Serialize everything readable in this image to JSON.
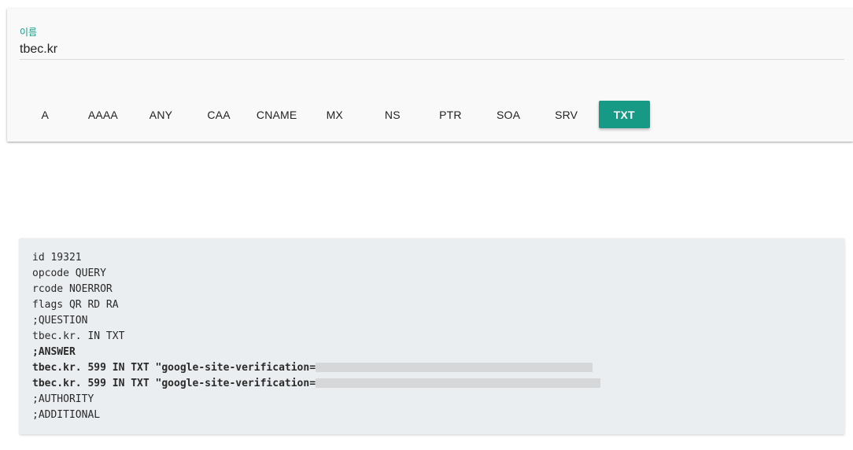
{
  "form": {
    "name_label": "이름",
    "name_value": "tbec.kr"
  },
  "record_types": [
    {
      "label": "A",
      "active": false
    },
    {
      "label": "AAAA",
      "active": false
    },
    {
      "label": "ANY",
      "active": false
    },
    {
      "label": "CAA",
      "active": false
    },
    {
      "label": "CNAME",
      "active": false
    },
    {
      "label": "MX",
      "active": false
    },
    {
      "label": "NS",
      "active": false
    },
    {
      "label": "PTR",
      "active": false
    },
    {
      "label": "SOA",
      "active": false
    },
    {
      "label": "SRV",
      "active": false
    },
    {
      "label": "TXT",
      "active": true
    }
  ],
  "result": {
    "id": "id 19321",
    "opcode": "opcode QUERY",
    "rcode": "rcode NOERROR",
    "flags": "flags QR RD RA",
    "question_header": ";QUESTION",
    "question": "tbec.kr. IN TXT",
    "answer_header": ";ANSWER",
    "answer_1": "tbec.kr. 599 IN TXT \"google-site-verification=",
    "answer_2": "tbec.kr. 599 IN TXT \"google-site-verification=",
    "authority_header": ";AUTHORITY",
    "additional_header": ";ADDITIONAL"
  },
  "colors": {
    "accent": "#179a85",
    "result_bg": "#ebeef0",
    "card_bg": "#f9f9f9"
  }
}
